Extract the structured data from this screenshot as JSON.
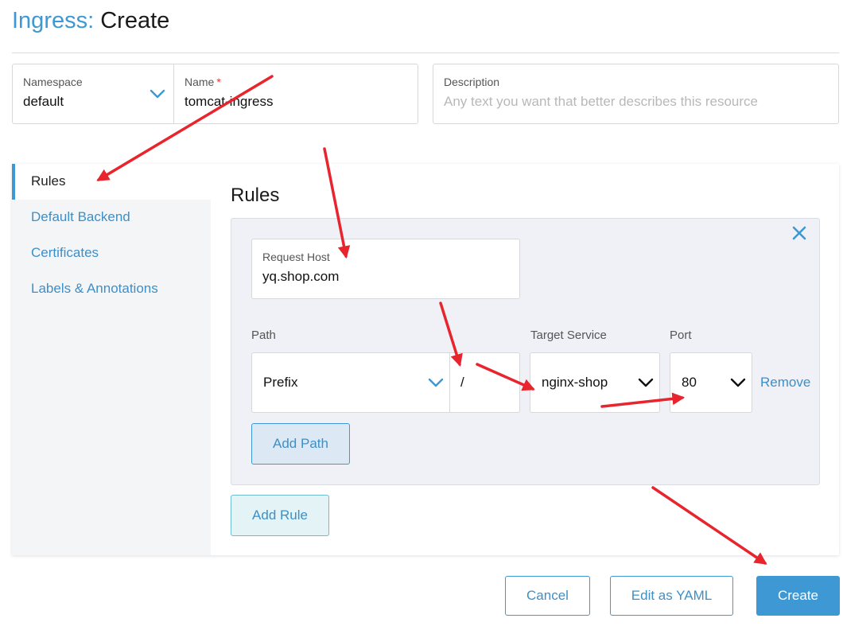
{
  "header": {
    "resource": "Ingress:",
    "action": "Create"
  },
  "form": {
    "namespace": {
      "label": "Namespace",
      "value": "default"
    },
    "name": {
      "label": "Name",
      "required_mark": "*",
      "value": "tomcat-ingress"
    },
    "description": {
      "label": "Description",
      "placeholder": "Any text you want that better describes this resource"
    }
  },
  "sidebar": {
    "items": [
      {
        "label": "Rules",
        "active": true
      },
      {
        "label": "Default Backend"
      },
      {
        "label": "Certificates"
      },
      {
        "label": "Labels & Annotations"
      }
    ]
  },
  "rules": {
    "heading": "Rules",
    "rule": {
      "request_host": {
        "label": "Request Host",
        "value": "yq.shop.com"
      },
      "path": {
        "label": "Path",
        "type_value": "Prefix",
        "value": "/"
      },
      "target_service": {
        "label": "Target Service",
        "value": "nginx-shop"
      },
      "port": {
        "label": "Port",
        "value": "80"
      },
      "remove_label": "Remove",
      "add_path_label": "Add Path",
      "close_icon": "close-icon"
    },
    "add_rule_label": "Add Rule"
  },
  "footer": {
    "cancel_label": "Cancel",
    "edit_yaml_label": "Edit as YAML",
    "create_label": "Create"
  },
  "colors": {
    "accent": "#3d98d3",
    "annotation": "#e8242d"
  }
}
